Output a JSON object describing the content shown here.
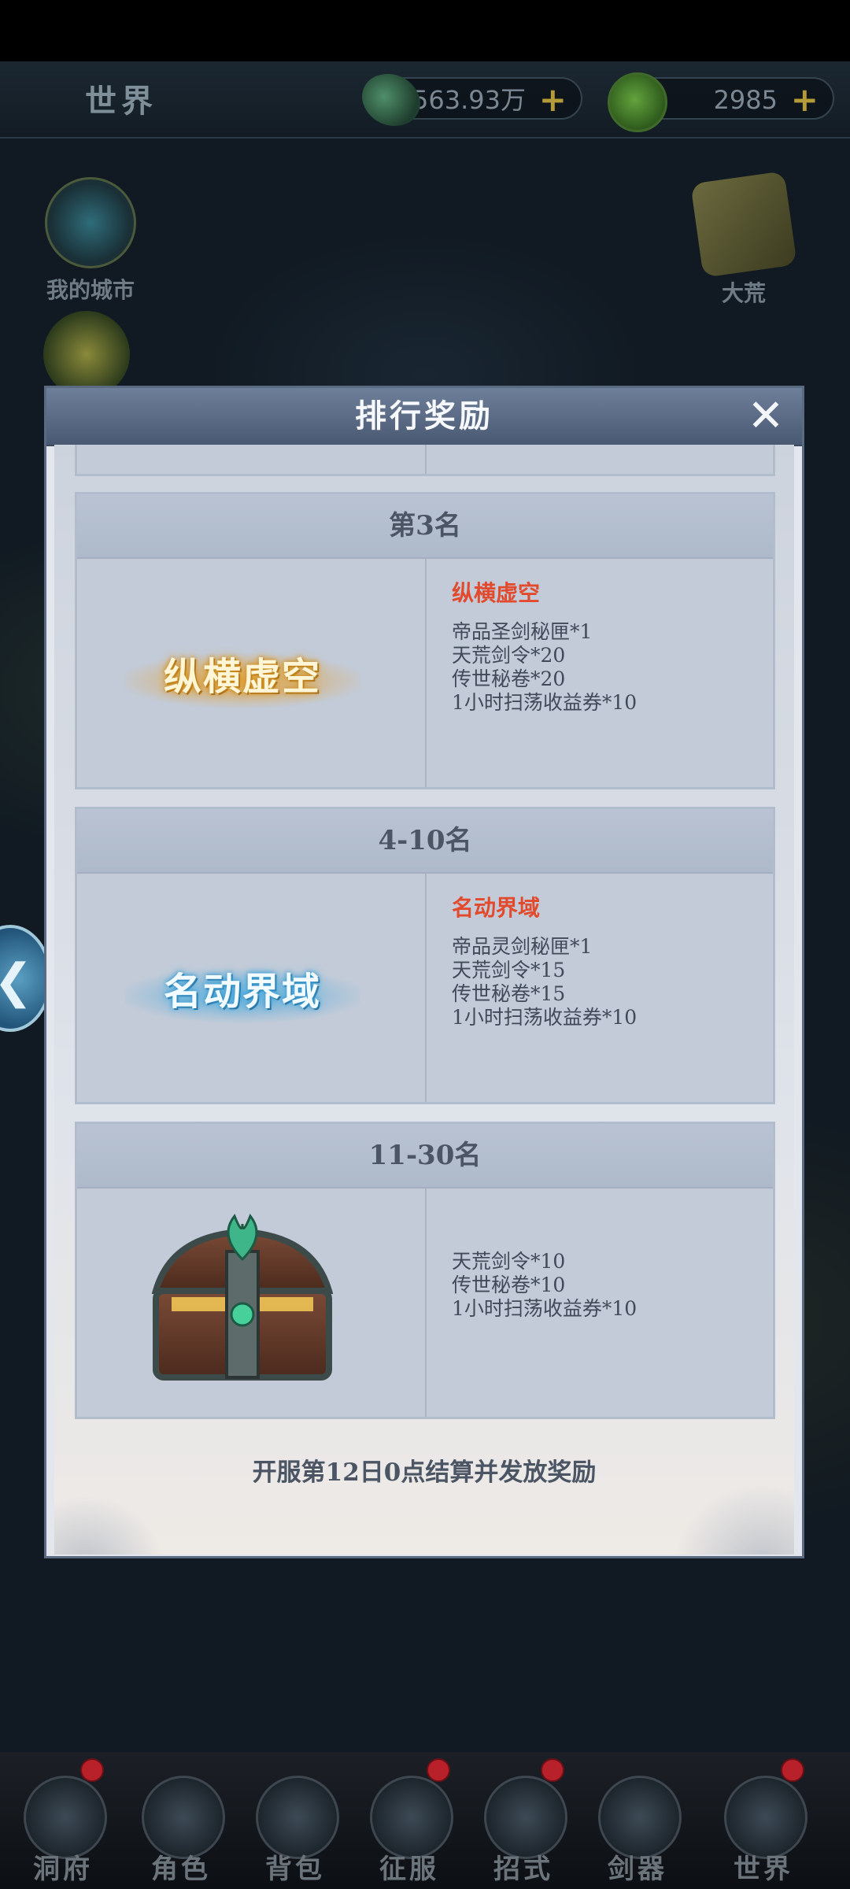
{
  "topbar": {
    "title": "世界",
    "currency1_value": "563.93万",
    "currency2_value": "2985",
    "plus_symbol": "+"
  },
  "map": {
    "my_city_label": "我的城市",
    "dahuang_label": "大荒"
  },
  "dialog": {
    "title": "排行奖励",
    "close_symbol": "✕",
    "footer_note": "开服第12日0点结算并发放奖励",
    "cards": [
      {
        "rank": "第3名",
        "badge_text": "纵横虚空",
        "reward_title": "纵横虚空",
        "items": [
          "帝品圣剑秘匣*1",
          "天荒剑令*20",
          "传世秘卷*20",
          "1小时扫荡收益券*10"
        ]
      },
      {
        "rank": "4-10名",
        "badge_text": "名动界域",
        "reward_title": "名动界域",
        "items": [
          "帝品灵剑秘匣*1",
          "天荒剑令*15",
          "传世秘卷*15",
          "1小时扫荡收益券*10"
        ]
      },
      {
        "rank": "11-30名",
        "badge_text": "",
        "reward_title": "",
        "items": [
          "天荒剑令*10",
          "传世秘卷*10",
          "1小时扫荡收益券*10"
        ]
      }
    ]
  },
  "bottom_nav": [
    {
      "label": "洞府",
      "dot": true
    },
    {
      "label": "角色",
      "dot": false
    },
    {
      "label": "背包",
      "dot": false
    },
    {
      "label": "征服",
      "dot": true
    },
    {
      "label": "招式",
      "dot": true
    },
    {
      "label": "剑器",
      "dot": false
    },
    {
      "label": "世界",
      "dot": true
    }
  ],
  "colors": {
    "reward_title": "#e24a2e",
    "dialog_header": "#5a6a86",
    "nav_dot": "#b8202a"
  }
}
